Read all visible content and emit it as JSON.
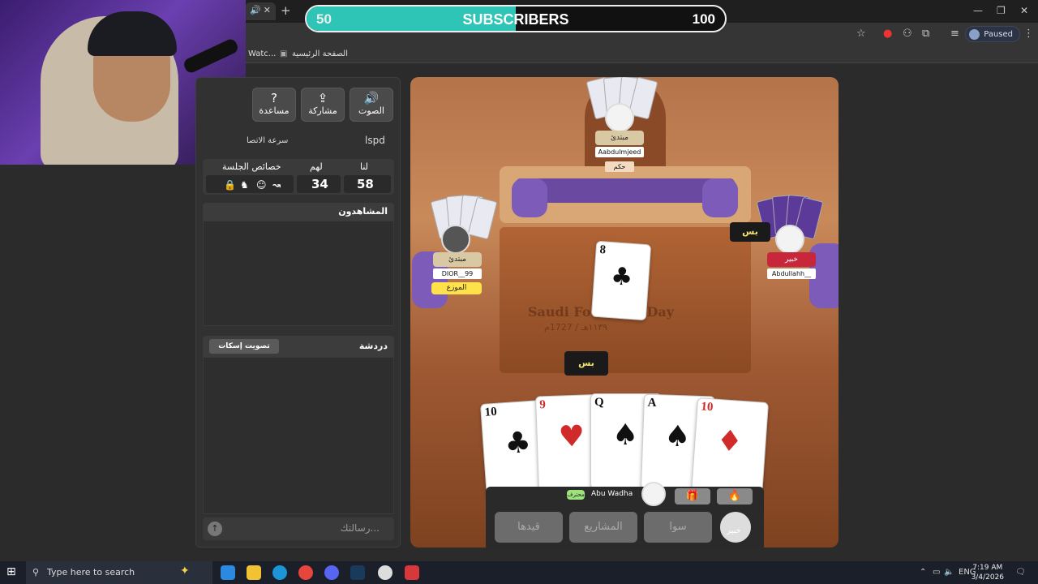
{
  "browser": {
    "tab_close": "✕",
    "new_tab": "+",
    "profile_status": "Paused",
    "bookmarks": [
      {
        "label": "Watc..."
      },
      {
        "label": "الصفحة الرئيسية"
      }
    ]
  },
  "overlay": {
    "subscriber_goal_label": "SUBSCRIBERS",
    "current": "50",
    "goal": "100",
    "progress_fraction": 0.5
  },
  "sidebar": {
    "buttons": [
      {
        "label": "الصوت",
        "icon": "speaker-icon"
      },
      {
        "label": "مشاركة",
        "icon": "share-icon"
      },
      {
        "label": "مساعدة",
        "icon": "help-icon"
      }
    ],
    "speed_label": "سرعة الاتصا",
    "room_id": "lspd",
    "score": {
      "us_label": "لنا",
      "them_label": "لهم",
      "session_label": "خصائص الجلسة",
      "us": "58",
      "them": "34"
    },
    "spectators_header": "المشاهدون",
    "chat_header": "دردشة",
    "mute_vote_label": "تصويت إسكات",
    "chat_placeholder": "رسالتك..."
  },
  "game": {
    "table_text_main": "Saudi Founding Day",
    "table_text_sub": "١١٣٩هـ / 1727م",
    "top_player": {
      "rank": "مبتدئ",
      "name": "Aabdulmjeed",
      "bid": "حكم"
    },
    "left_player": {
      "rank": "مبتدئ",
      "name": "DIOR__99",
      "role": "الموزع"
    },
    "right_player": {
      "rank": "خبير",
      "name": "Abdullahh__",
      "bubble": "بس"
    },
    "center_bubble": "بس",
    "played_card": {
      "rank": "8",
      "suit": "♣"
    },
    "hand": [
      {
        "rank": "10",
        "suit": "♣",
        "color": "#111111"
      },
      {
        "rank": "9",
        "suit": "♥",
        "color": "#d12a2a"
      },
      {
        "rank": "Q",
        "suit": "♠",
        "color": "#111111"
      },
      {
        "rank": "A",
        "suit": "♠",
        "color": "#111111"
      },
      {
        "rank": "10",
        "suit": "♦",
        "color": "#d12a2a"
      }
    ],
    "self": {
      "name": "Abu Wadha",
      "badge": "محترف",
      "rank": "خبير"
    },
    "actions": [
      {
        "label": "قيدها"
      },
      {
        "label": "المشاريع"
      },
      {
        "label": "سوا"
      }
    ]
  },
  "taskbar": {
    "search_placeholder": "Type here to search",
    "lang": "ENG",
    "time": "7:19 AM",
    "date": "3/4/2026"
  }
}
